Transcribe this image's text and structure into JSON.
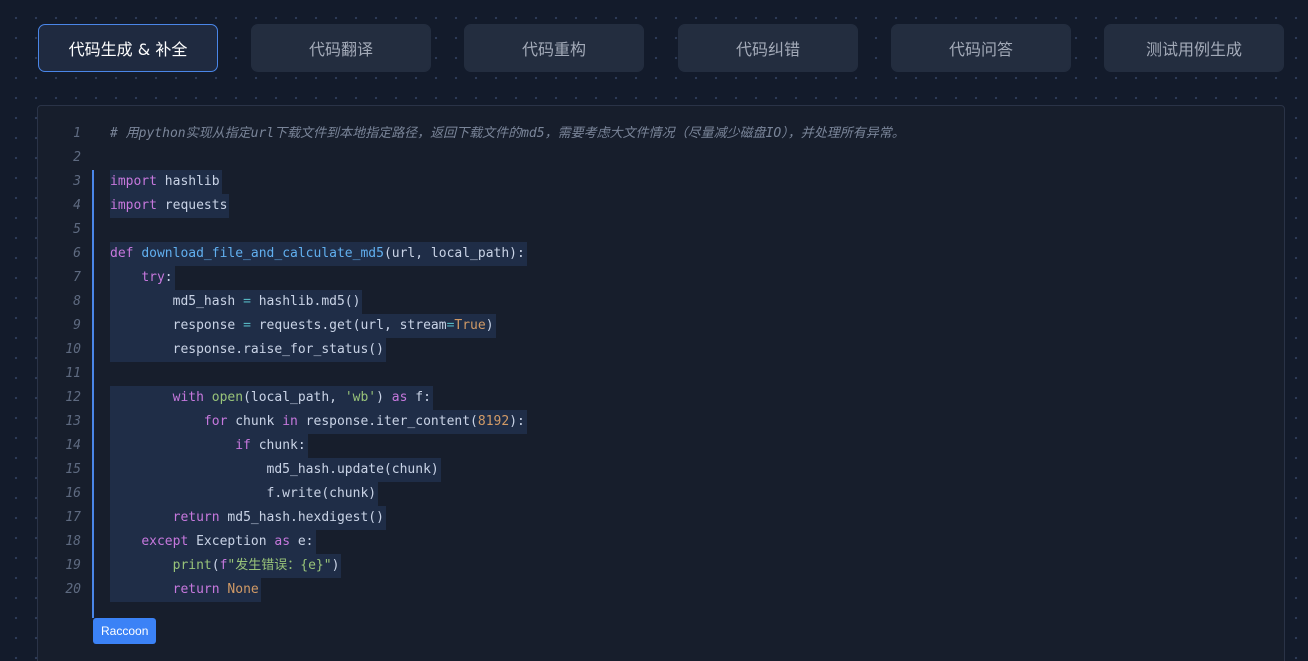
{
  "tabs": [
    {
      "label": "代码生成 & 补全",
      "active": true
    },
    {
      "label": "代码翻译",
      "active": false
    },
    {
      "label": "代码重构",
      "active": false
    },
    {
      "label": "代码纠错",
      "active": false
    },
    {
      "label": "代码问答",
      "active": false
    },
    {
      "label": "测试用例生成",
      "active": false
    }
  ],
  "editor": {
    "badge_label": "Raccoon",
    "lines": [
      {
        "n": "1",
        "text": "# 用python实现从指定url下载文件到本地指定路径，返回下载文件的md5，需要考虑大文件情况（尽量减少磁盘IO），并处理所有异常。"
      },
      {
        "n": "2",
        "text": ""
      },
      {
        "n": "3",
        "text": "import hashlib"
      },
      {
        "n": "4",
        "text": "import requests"
      },
      {
        "n": "5",
        "text": ""
      },
      {
        "n": "6",
        "text": "def download_file_and_calculate_md5(url, local_path):"
      },
      {
        "n": "7",
        "text": "    try:"
      },
      {
        "n": "8",
        "text": "        md5_hash = hashlib.md5()"
      },
      {
        "n": "9",
        "text": "        response = requests.get(url, stream=True)"
      },
      {
        "n": "10",
        "text": "        response.raise_for_status()"
      },
      {
        "n": "11",
        "text": ""
      },
      {
        "n": "12",
        "text": "        with open(local_path, 'wb') as f:"
      },
      {
        "n": "13",
        "text": "            for chunk in response.iter_content(8192):"
      },
      {
        "n": "14",
        "text": "                if chunk:"
      },
      {
        "n": "15",
        "text": "                    md5_hash.update(chunk)"
      },
      {
        "n": "16",
        "text": "                    f.write(chunk)"
      },
      {
        "n": "17",
        "text": "        return md5_hash.hexdigest()"
      },
      {
        "n": "18",
        "text": "    except Exception as e:"
      },
      {
        "n": "19",
        "text": "        print(f\"发生错误：{e}\")"
      },
      {
        "n": "20",
        "text": "        return None"
      }
    ]
  },
  "colors": {
    "accent": "#4a86e8",
    "keyword": "#c678dd",
    "function": "#61afef",
    "string": "#98c379",
    "number": "#d19a66"
  }
}
